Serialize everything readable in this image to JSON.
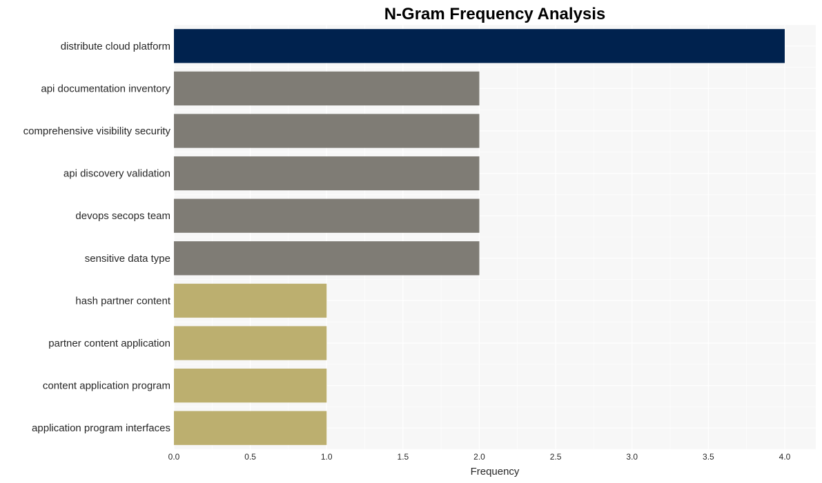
{
  "chart_data": {
    "type": "bar",
    "orientation": "horizontal",
    "title": "N-Gram Frequency Analysis",
    "xlabel": "Frequency",
    "ylabel": "",
    "xlim": [
      0,
      4.2
    ],
    "xticks": [
      "0.0",
      "0.5",
      "1.0",
      "1.5",
      "2.0",
      "2.5",
      "3.0",
      "3.5",
      "4.0"
    ],
    "grid": true,
    "categories": [
      "distribute cloud platform",
      "api documentation inventory",
      "comprehensive visibility security",
      "api discovery validation",
      "devops secops team",
      "sensitive data type",
      "hash partner content",
      "partner content application",
      "content application program",
      "application program interfaces"
    ],
    "values": [
      4,
      2,
      2,
      2,
      2,
      2,
      1,
      1,
      1,
      1
    ],
    "colors": {
      "4": "#00224e",
      "2": "#7f7c75",
      "1": "#bcaf6f"
    },
    "plot_background": "#f7f7f7",
    "grid_color": "#ffffff"
  }
}
